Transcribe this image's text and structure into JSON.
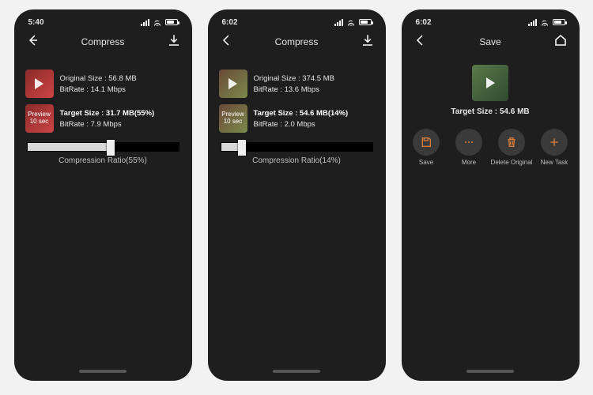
{
  "screens": [
    {
      "time": "5:40",
      "title": "Compress",
      "left_icon": "back",
      "right_icon": "download",
      "thumb_style": "red",
      "original_size_label": "Original Size : 56.8 MB",
      "original_bitrate_label": "BitRate : 14.1 Mbps",
      "target_size_label": "Target Size : 31.7 MB(55%)",
      "target_bitrate_label": "BitRate : 7.9 Mbps",
      "preview_label_top": "Preview",
      "preview_label_bottom": "10 sec",
      "slider_percent": 55,
      "ratio_label": "Compression Ratio(55%)"
    },
    {
      "time": "6:02",
      "title": "Compress",
      "left_icon": "back",
      "right_icon": "download",
      "thumb_style": "green",
      "original_size_label": "Original Size : 374.5 MB",
      "original_bitrate_label": "BitRate : 13.6 Mbps",
      "target_size_label": "Target Size : 54.6 MB(14%)",
      "target_bitrate_label": "BitRate : 2.0 Mbps",
      "preview_label_top": "Preview",
      "preview_label_bottom": "10 sec",
      "slider_percent": 14,
      "ratio_label": "Compression Ratio(14%)"
    }
  ],
  "save_screen": {
    "time": "6:02",
    "title": "Save",
    "left_icon": "back",
    "right_icon": "home",
    "target_size_label": "Target Size : 54.6 MB",
    "actions": [
      {
        "icon": "save",
        "label": "Save"
      },
      {
        "icon": "more",
        "label": "More"
      },
      {
        "icon": "trash",
        "label": "Delete Original"
      },
      {
        "icon": "plus",
        "label": "New Task"
      }
    ]
  }
}
